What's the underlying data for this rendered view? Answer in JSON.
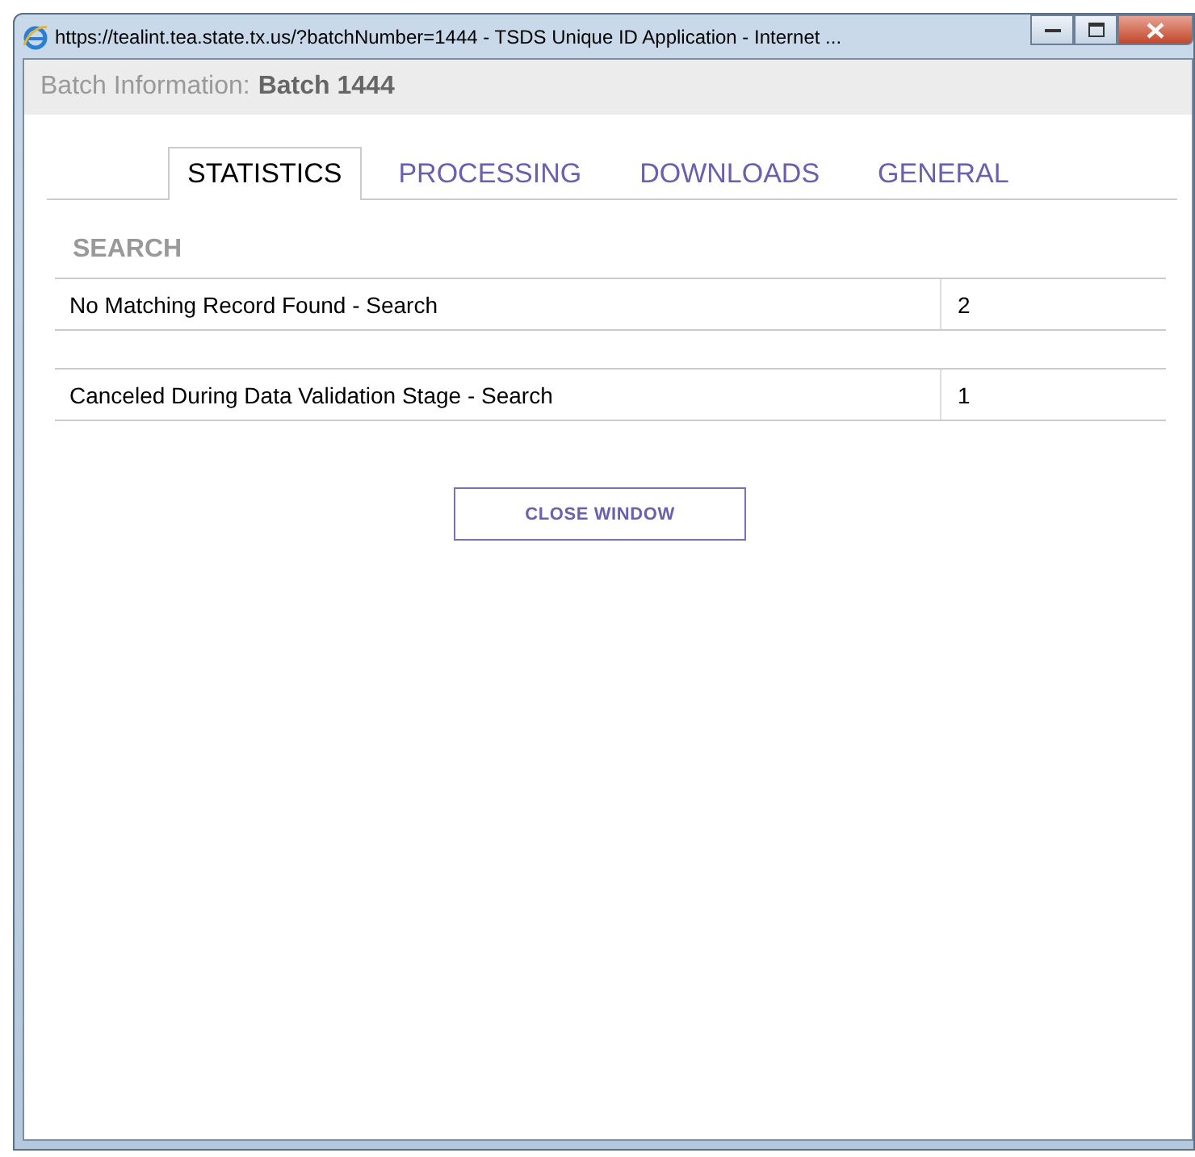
{
  "window": {
    "title": "https://tealint.tea.state.tx.us/?batchNumber=1444 - TSDS Unique ID Application - Internet ..."
  },
  "header": {
    "label": "Batch Information:",
    "batch": "Batch 1444"
  },
  "tabs": [
    {
      "label": "STATISTICS",
      "selected": true
    },
    {
      "label": "PROCESSING",
      "selected": false
    },
    {
      "label": "DOWNLOADS",
      "selected": false
    },
    {
      "label": "GENERAL",
      "selected": false
    }
  ],
  "section": {
    "title": "SEARCH"
  },
  "table": {
    "rows": [
      {
        "label": "No Matching Record Found - Search",
        "value": "2"
      },
      {
        "label": "Canceled During Data Validation Stage - Search",
        "value": "1"
      }
    ]
  },
  "buttons": [
    "CLOSE WINDOW"
  ]
}
